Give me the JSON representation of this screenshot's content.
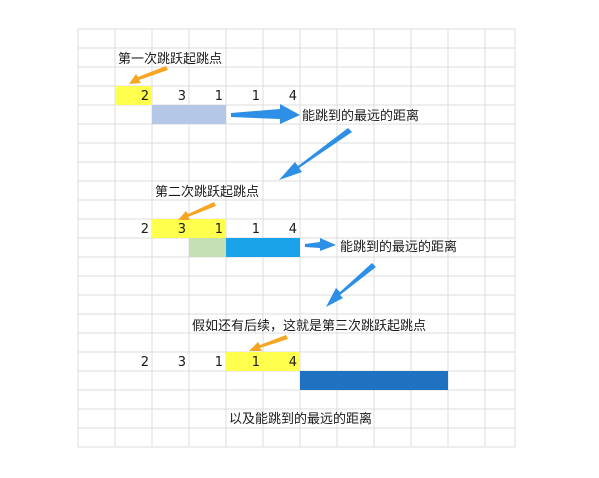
{
  "labels": {
    "first_jump_start": "第一次跳跃起跳点",
    "farthest_1": "能跳到的最远的距离",
    "second_jump_start": "第二次跳跃起跳点",
    "farthest_2": "能跳到的最远的距离",
    "third_jump_start": "假如还有后续，这就是第三次跳跃起跳点",
    "farthest_3": "以及能跳到的最远的距离"
  },
  "array": [
    "2",
    "3",
    "1",
    "1",
    "4"
  ],
  "colors": {
    "yellow": "#ffff4d",
    "light_blue": "#b4c7e7",
    "light_green": "#c5e0b4",
    "cyan": "#1aa3e8",
    "dark_blue": "#1f72c0",
    "arrow_orange": "#f6a623",
    "arrow_blue": "#2e8fe6"
  }
}
